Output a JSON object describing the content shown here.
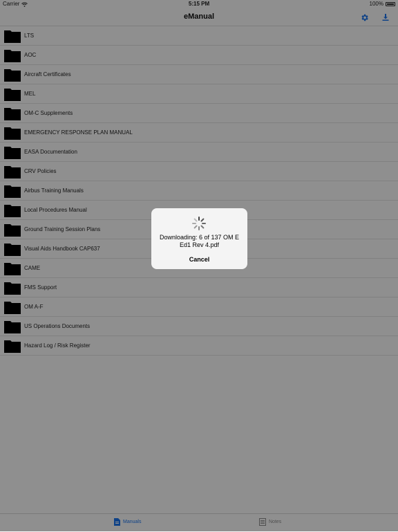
{
  "status": {
    "carrier": "Carrier",
    "time": "5:15 PM",
    "battery": "100%"
  },
  "nav": {
    "title": "eManual",
    "settings_icon": "gear-icon",
    "download_icon": "download-icon"
  },
  "folders": [
    "LTS",
    "AOC",
    "Aircraft Certificates",
    "MEL",
    "OM-C Supplements",
    "EMERGENCY RESPONSE PLAN MANUAL",
    "EASA Documentation",
    "CRV Policies",
    "Airbus Training Manuals",
    "Local Procedures Manual",
    "Ground Training Session Plans",
    "Visual Aids Handbook CAP637",
    "CAME",
    "FMS Support",
    "OM A-F",
    "US Operations Documents",
    "Hazard Log / Risk Register"
  ],
  "tabs": [
    {
      "label": "Manuals",
      "icon": "document-icon",
      "selected": true
    },
    {
      "label": "Notes",
      "icon": "notes-icon",
      "selected": false
    }
  ],
  "alert": {
    "message": "Downloading: 6 of 137 OM E Ed1 Rev 4.pdf",
    "cancel_label": "Cancel",
    "progress_icon": "spinner-icon"
  },
  "colors": {
    "accent": "#1a73e8",
    "folder": "#000000",
    "overlay": "rgba(0,0,0,0.42)"
  }
}
